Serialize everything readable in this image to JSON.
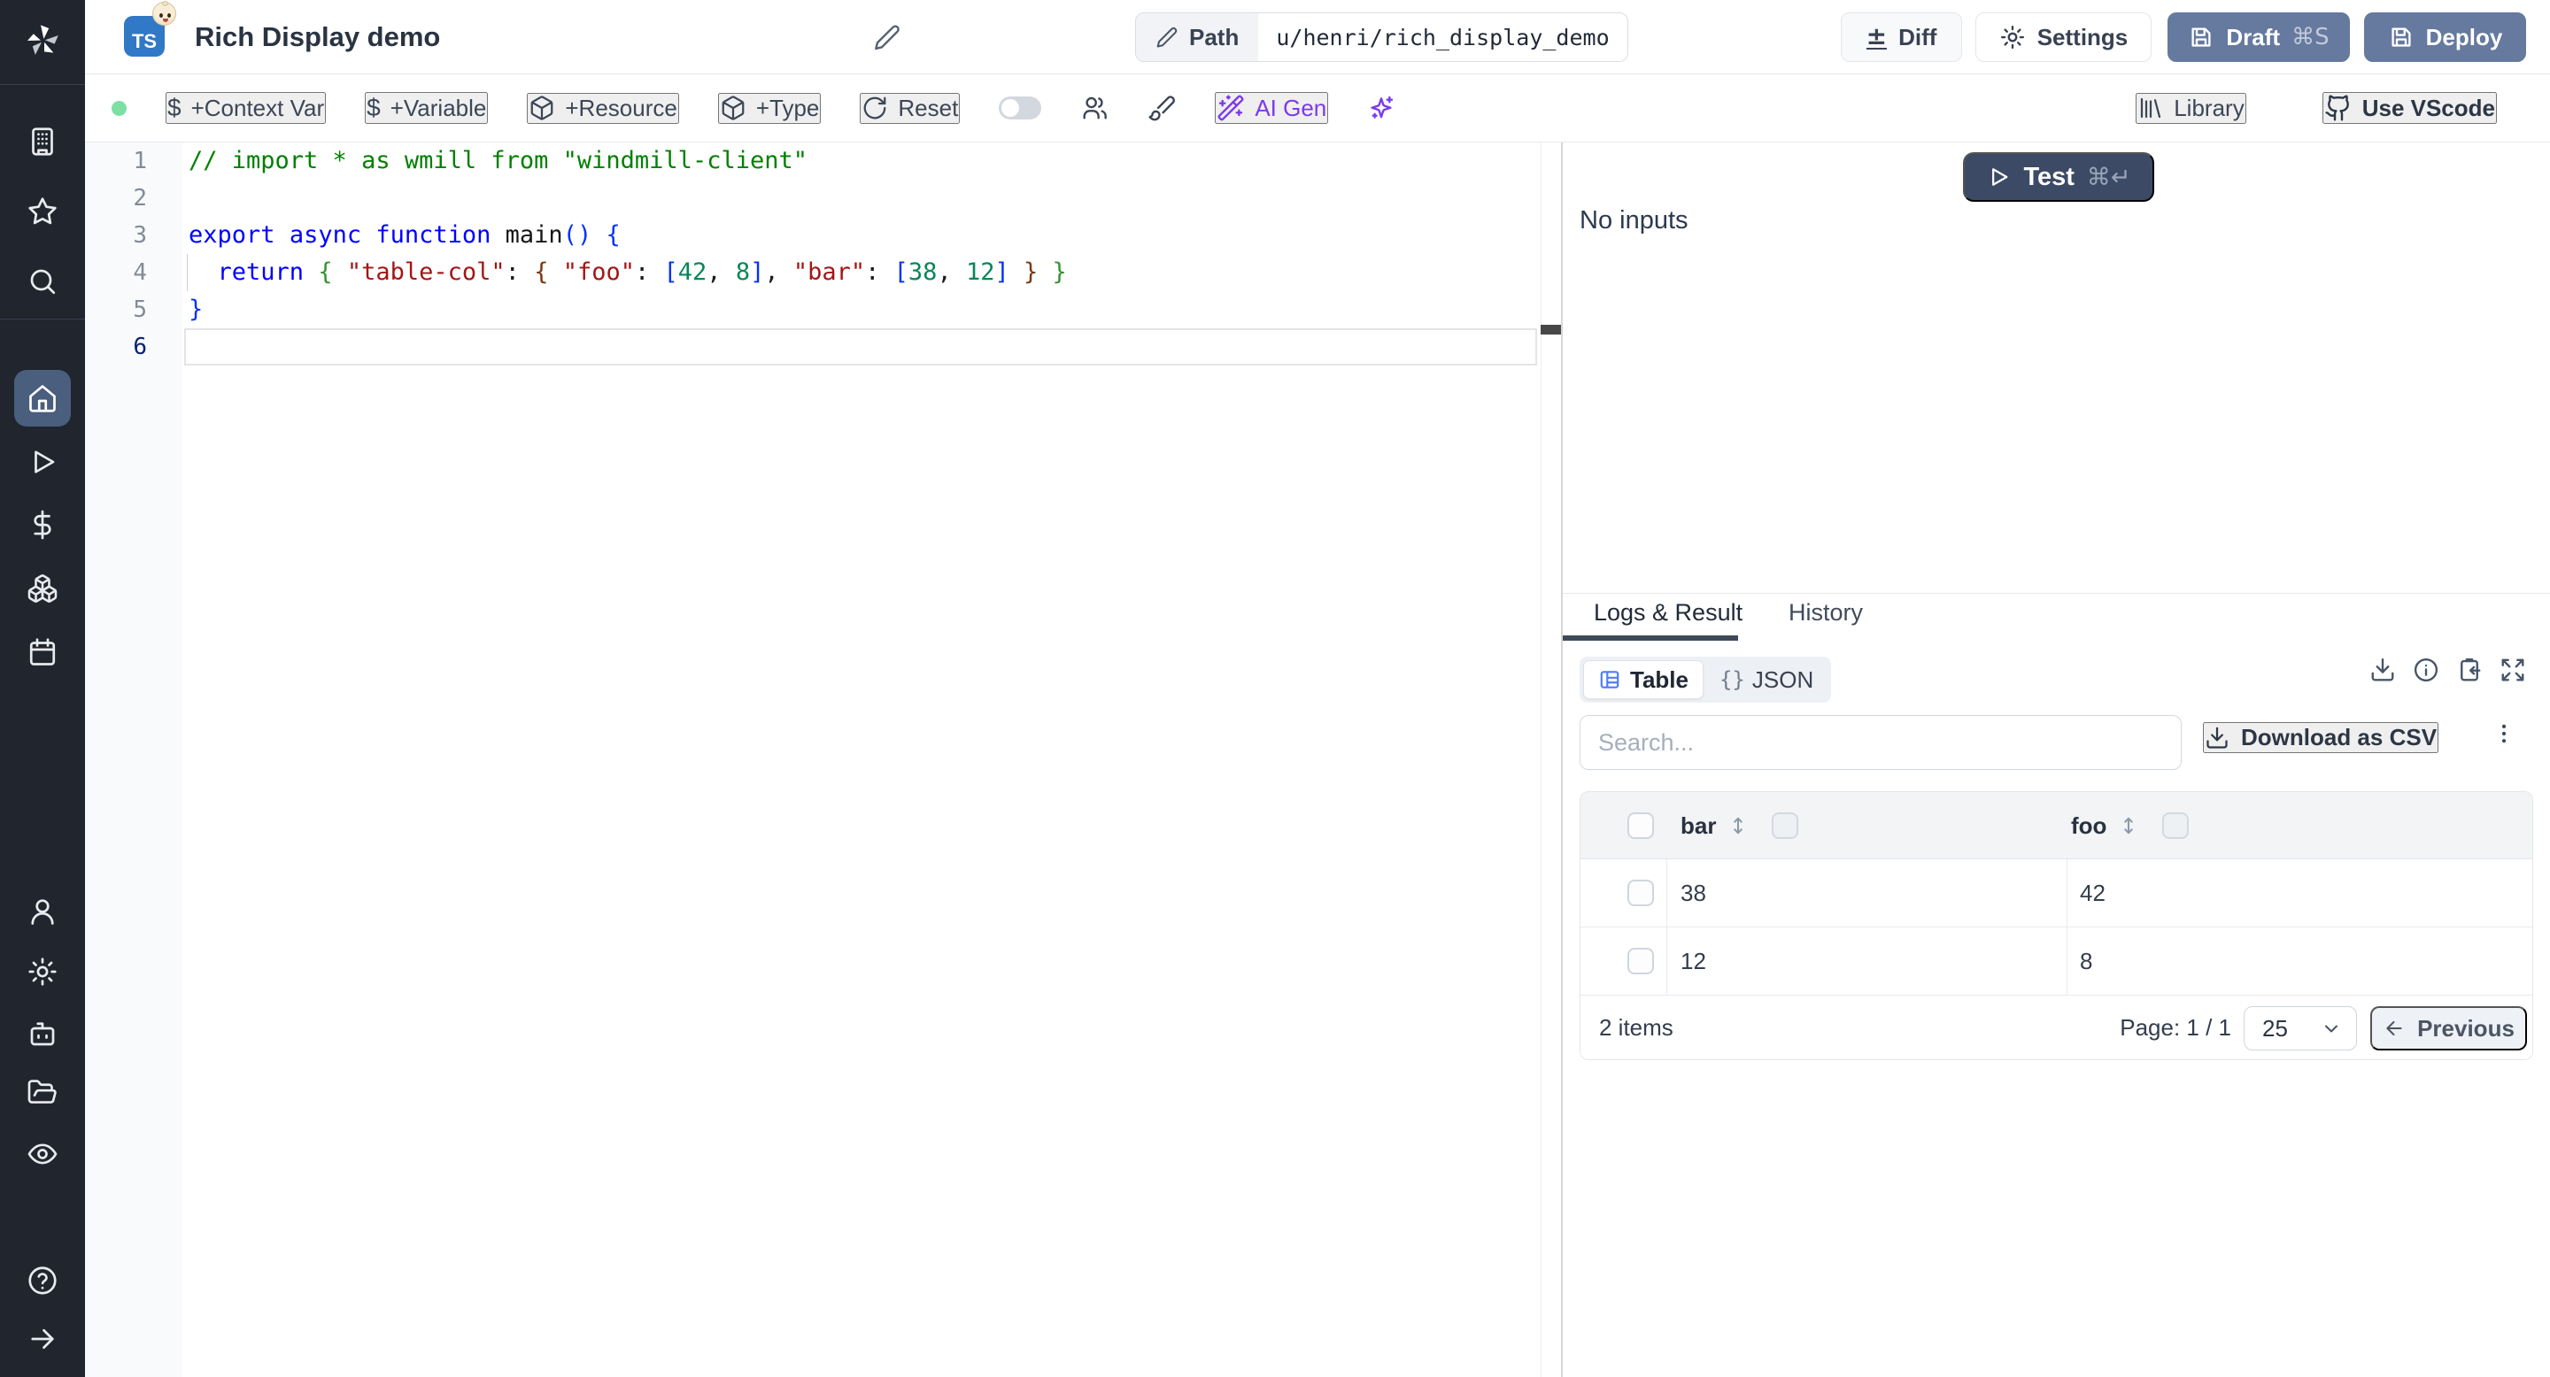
{
  "header": {
    "badge": "TS",
    "title": "Rich Display demo",
    "path_label": "Path",
    "path_value": "u/henri/rich_display_demo",
    "diff_label": "Diff",
    "diff_symbol": "±",
    "settings_label": "Settings",
    "draft_label": "Draft",
    "draft_shortcut": "⌘S",
    "deploy_label": "Deploy"
  },
  "toolbar": {
    "dollar": "$",
    "context_var": "+Context Var",
    "variable": "+Variable",
    "resource": "+Resource",
    "type": "+Type",
    "reset": "Reset",
    "ai_gen": "AI Gen",
    "library": "Library",
    "use_vscode": "Use VScode"
  },
  "sidebar": {
    "icons": [
      "windmill-logo",
      "building",
      "star",
      "search",
      "home",
      "play",
      "dollar",
      "boxes",
      "calendar",
      "user",
      "gear",
      "robot",
      "folder-open",
      "eye",
      "help-circle",
      "arrow-right"
    ]
  },
  "editor": {
    "active_line": 6,
    "lines": [
      {
        "n": 1,
        "tokens": [
          [
            "comment",
            "// import * as wmill from \"windmill-client\""
          ]
        ]
      },
      {
        "n": 2,
        "tokens": []
      },
      {
        "n": 3,
        "tokens": [
          [
            "kw",
            "export"
          ],
          [
            "plain",
            " "
          ],
          [
            "kw",
            "async"
          ],
          [
            "plain",
            " "
          ],
          [
            "kw",
            "function"
          ],
          [
            "fn",
            " main"
          ],
          [
            "b1",
            "("
          ],
          [
            "b1",
            ")"
          ],
          [
            "plain",
            " "
          ],
          [
            "b1",
            "{"
          ]
        ]
      },
      {
        "n": 4,
        "tokens": [
          [
            "plain",
            "  "
          ],
          [
            "kw",
            "return"
          ],
          [
            "plain",
            " "
          ],
          [
            "b2",
            "{"
          ],
          [
            "plain",
            " "
          ],
          [
            "str",
            "\"table-col\""
          ],
          [
            "plain",
            ": "
          ],
          [
            "b3",
            "{"
          ],
          [
            "plain",
            " "
          ],
          [
            "str",
            "\"foo\""
          ],
          [
            "plain",
            ": "
          ],
          [
            "b1",
            "["
          ],
          [
            "num",
            "42"
          ],
          [
            "plain",
            ", "
          ],
          [
            "num",
            "8"
          ],
          [
            "b1",
            "]"
          ],
          [
            "plain",
            ", "
          ],
          [
            "str",
            "\"bar\""
          ],
          [
            "plain",
            ": "
          ],
          [
            "b1",
            "["
          ],
          [
            "num",
            "38"
          ],
          [
            "plain",
            ", "
          ],
          [
            "num",
            "12"
          ],
          [
            "b1",
            "]"
          ],
          [
            "plain",
            " "
          ],
          [
            "b3",
            "}"
          ],
          [
            "plain",
            " "
          ],
          [
            "b2",
            "}"
          ]
        ]
      },
      {
        "n": 5,
        "tokens": [
          [
            "b1",
            "}"
          ]
        ]
      },
      {
        "n": 6,
        "tokens": []
      }
    ]
  },
  "run_panel": {
    "test_label": "Test",
    "test_shortcut": "⌘↵",
    "no_inputs": "No inputs"
  },
  "result_panel": {
    "tab_logs": "Logs & Result",
    "tab_history": "History",
    "view_table": "Table",
    "view_json_braces": "{}",
    "view_json": "JSON",
    "search_placeholder": "Search...",
    "download_csv": "Download as CSV",
    "table": {
      "columns": [
        "bar",
        "foo"
      ],
      "rows": [
        [
          "38",
          "42"
        ],
        [
          "12",
          "8"
        ]
      ],
      "items_label": "2 items",
      "page_label": "Page: 1 / 1",
      "page_size": "25",
      "previous_label": "Previous"
    }
  },
  "colors": {
    "ts_badge_blue": "#3178c6",
    "header_button_slate": "#66799e",
    "test_button_navy": "#3d4a66",
    "ai_purple": "#7c3aed",
    "sidebar_bg": "#20252e",
    "sidebar_active": "#4a5e7e",
    "status_green": "#7ce0a3",
    "table_icon_blue": "#4f7df7"
  }
}
